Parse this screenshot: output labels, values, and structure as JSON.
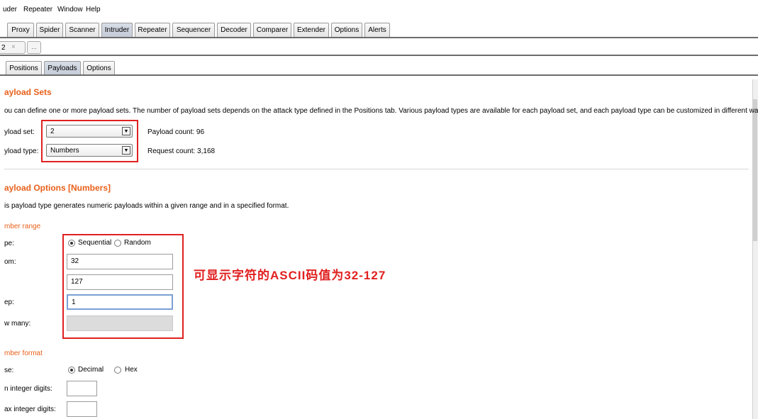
{
  "menu": [
    "uder",
    "Repeater",
    "Window",
    "Help"
  ],
  "main_tabs": [
    "Proxy",
    "Spider",
    "Scanner",
    "Intruder",
    "Repeater",
    "Sequencer",
    "Decoder",
    "Comparer",
    "Extender",
    "Options",
    "Alerts"
  ],
  "attack_tabs": {
    "first": "2",
    "close": "×",
    "more": "..."
  },
  "sub_tabs": [
    "Positions",
    "Payloads",
    "Options"
  ],
  "payload_sets": {
    "heading": "ayload Sets",
    "description": "ou can define one or more payload sets. The number of payload sets depends on the attack type defined in the Positions tab. Various payload types are available for each payload set, and each payload type can be customized in different ways.",
    "set_label": "yload set:",
    "set_value": "2",
    "type_label": "yload type:",
    "type_value": "Numbers",
    "payload_count": "Payload count:  96",
    "request_count": "Request count:  3,168"
  },
  "payload_options": {
    "heading": "ayload Options [Numbers]",
    "description": "is payload type generates numeric payloads within a given range and in a specified format.",
    "range_section": "mber range",
    "type_label": "pe:",
    "sequential": "Sequential",
    "random": "Random",
    "from_label": "om:",
    "from_value": "32",
    "to_label": "",
    "to_value": "127",
    "step_label": "ep:",
    "step_value": "1",
    "how_many_label": "w many:",
    "how_many_value": "",
    "format_section": "mber format",
    "base_label": "se:",
    "decimal": "Decimal",
    "hex": "Hex",
    "min_int_label": "n integer digits:",
    "max_int_label": "ax integer digits:"
  },
  "annotation": "可显示字符的ASCII码值为32-127",
  "colors": {
    "heading": "#e8601a",
    "annotation": "#e02020",
    "active_tab": "#c5ccd8"
  }
}
